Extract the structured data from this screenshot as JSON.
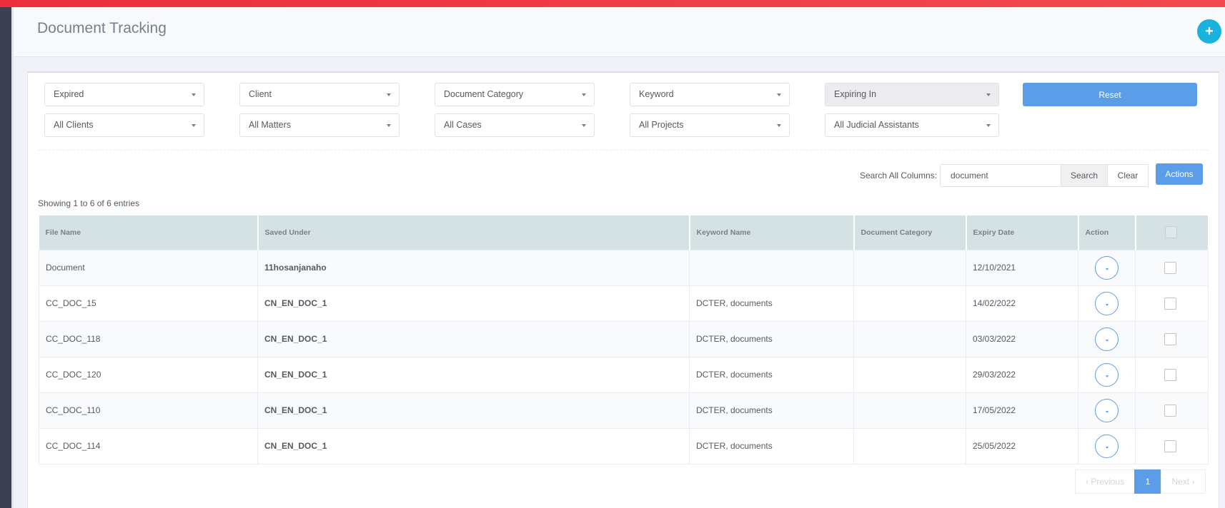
{
  "page": {
    "title": "Document Tracking",
    "add_button": "+"
  },
  "filters": {
    "row1": [
      "Expired",
      "Client",
      "Document Category",
      "Keyword",
      "Expiring In"
    ],
    "row2": [
      "All Clients",
      "All Matters",
      "All Cases",
      "All Projects",
      "All Judicial Assistants"
    ],
    "reset_label": "Reset"
  },
  "search": {
    "label": "Search All Columns:",
    "value": "document",
    "search_label": "Search",
    "clear_label": "Clear",
    "actions_label": "Actions"
  },
  "table": {
    "info": "Showing 1 to 6 of 6 entries",
    "headers": [
      "File Name",
      "Saved Under",
      "Keyword Name",
      "Document Category",
      "Expiry Date",
      "Action"
    ],
    "rows": [
      {
        "file": "Document",
        "saved": "11hosanjanaho",
        "keyword": "",
        "category": "",
        "expiry": "12/10/2021"
      },
      {
        "file": "CC_DOC_15",
        "saved": "CN_EN_DOC_1",
        "keyword": "DCTER, documents",
        "category": "",
        "expiry": "14/02/2022"
      },
      {
        "file": "CC_DOC_118",
        "saved": "CN_EN_DOC_1",
        "keyword": "DCTER, documents",
        "category": "",
        "expiry": "03/03/2022"
      },
      {
        "file": "CC_DOC_120",
        "saved": "CN_EN_DOC_1",
        "keyword": "DCTER, documents",
        "category": "",
        "expiry": "29/03/2022"
      },
      {
        "file": "CC_DOC_110",
        "saved": "CN_EN_DOC_1",
        "keyword": "DCTER, documents",
        "category": "",
        "expiry": "17/05/2022"
      },
      {
        "file": "CC_DOC_114",
        "saved": "CN_EN_DOC_1",
        "keyword": "DCTER, documents",
        "category": "",
        "expiry": "25/05/2022"
      }
    ]
  },
  "pagination": {
    "previous": "Previous",
    "current": "1",
    "next": "Next"
  },
  "colors": {
    "accent": "#5c9de9",
    "top_bar": "#ea2f3b",
    "add_button": "#1ab3de",
    "table_header": "#d5e2e4"
  },
  "icons": {
    "add": "plus-icon",
    "dropdown": "chevron-down-icon",
    "prev": "chevron-left-icon",
    "next": "chevron-right-icon"
  }
}
